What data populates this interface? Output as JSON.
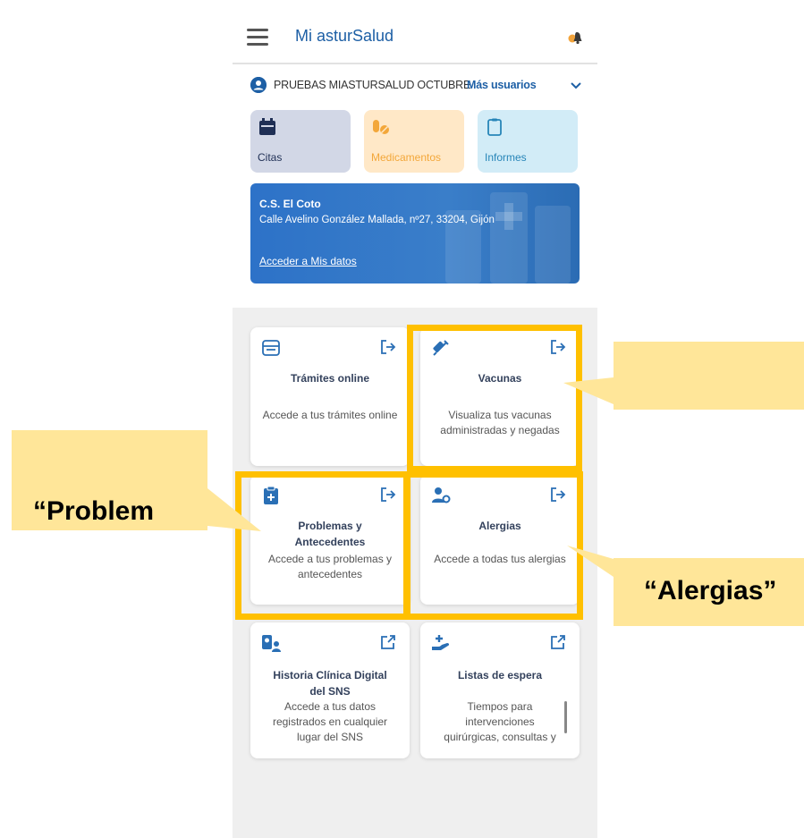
{
  "header": {
    "title": "Mi asturSalud"
  },
  "user": {
    "name": "PRUEBAS MIASTURSALUD OCTUBRE",
    "more_users": "Más usuarios"
  },
  "quick_access": [
    {
      "label": "Citas",
      "icon": "calendar-icon",
      "color": "#1f2f55"
    },
    {
      "label": "Medicamentos",
      "icon": "pills-icon",
      "color": "#f3a73a"
    },
    {
      "label": "Informes",
      "icon": "clipboard-icon",
      "color": "#2785b8"
    }
  ],
  "health_center": {
    "name": "C.S. El Coto",
    "address": "Calle Avelino González Mallada, nº27, 33204, Gijón",
    "link": "Acceder a Mis datos"
  },
  "services": [
    {
      "title": "Trámites online",
      "description": "Accede a tus trámites online",
      "icon": "inbox-icon",
      "action_icon": "exit-icon"
    },
    {
      "title": "Vacunas",
      "description": "Visualiza tus vacunas administradas y negadas",
      "icon": "syringe-icon",
      "action_icon": "exit-icon"
    },
    {
      "title": "Problemas y Antecedentes",
      "description": "Accede a tus problemas y antecedentes",
      "icon": "medical-clipboard-icon",
      "action_icon": "exit-icon"
    },
    {
      "title": "Alergias",
      "description": "Accede a todas tus alergias",
      "icon": "user-gear-icon",
      "action_icon": "exit-icon"
    },
    {
      "title": "Historia Clínica Digital del SNS",
      "description": "Accede a tus datos registrados en cualquier lugar del SNS",
      "icon": "patient-record-icon",
      "action_icon": "external-link-icon"
    },
    {
      "title": "Listas de espera",
      "description": "Tiempos para intervenciones quirúrgicas, consultas y",
      "icon": "hand-plus-icon",
      "action_icon": "external-link-icon"
    }
  ],
  "annotations": {
    "left": "“Problem",
    "right_top": "",
    "right_bottom": "“Alergias”",
    "highlight_color": "#ffc000",
    "callout_color": "#ffe699"
  }
}
